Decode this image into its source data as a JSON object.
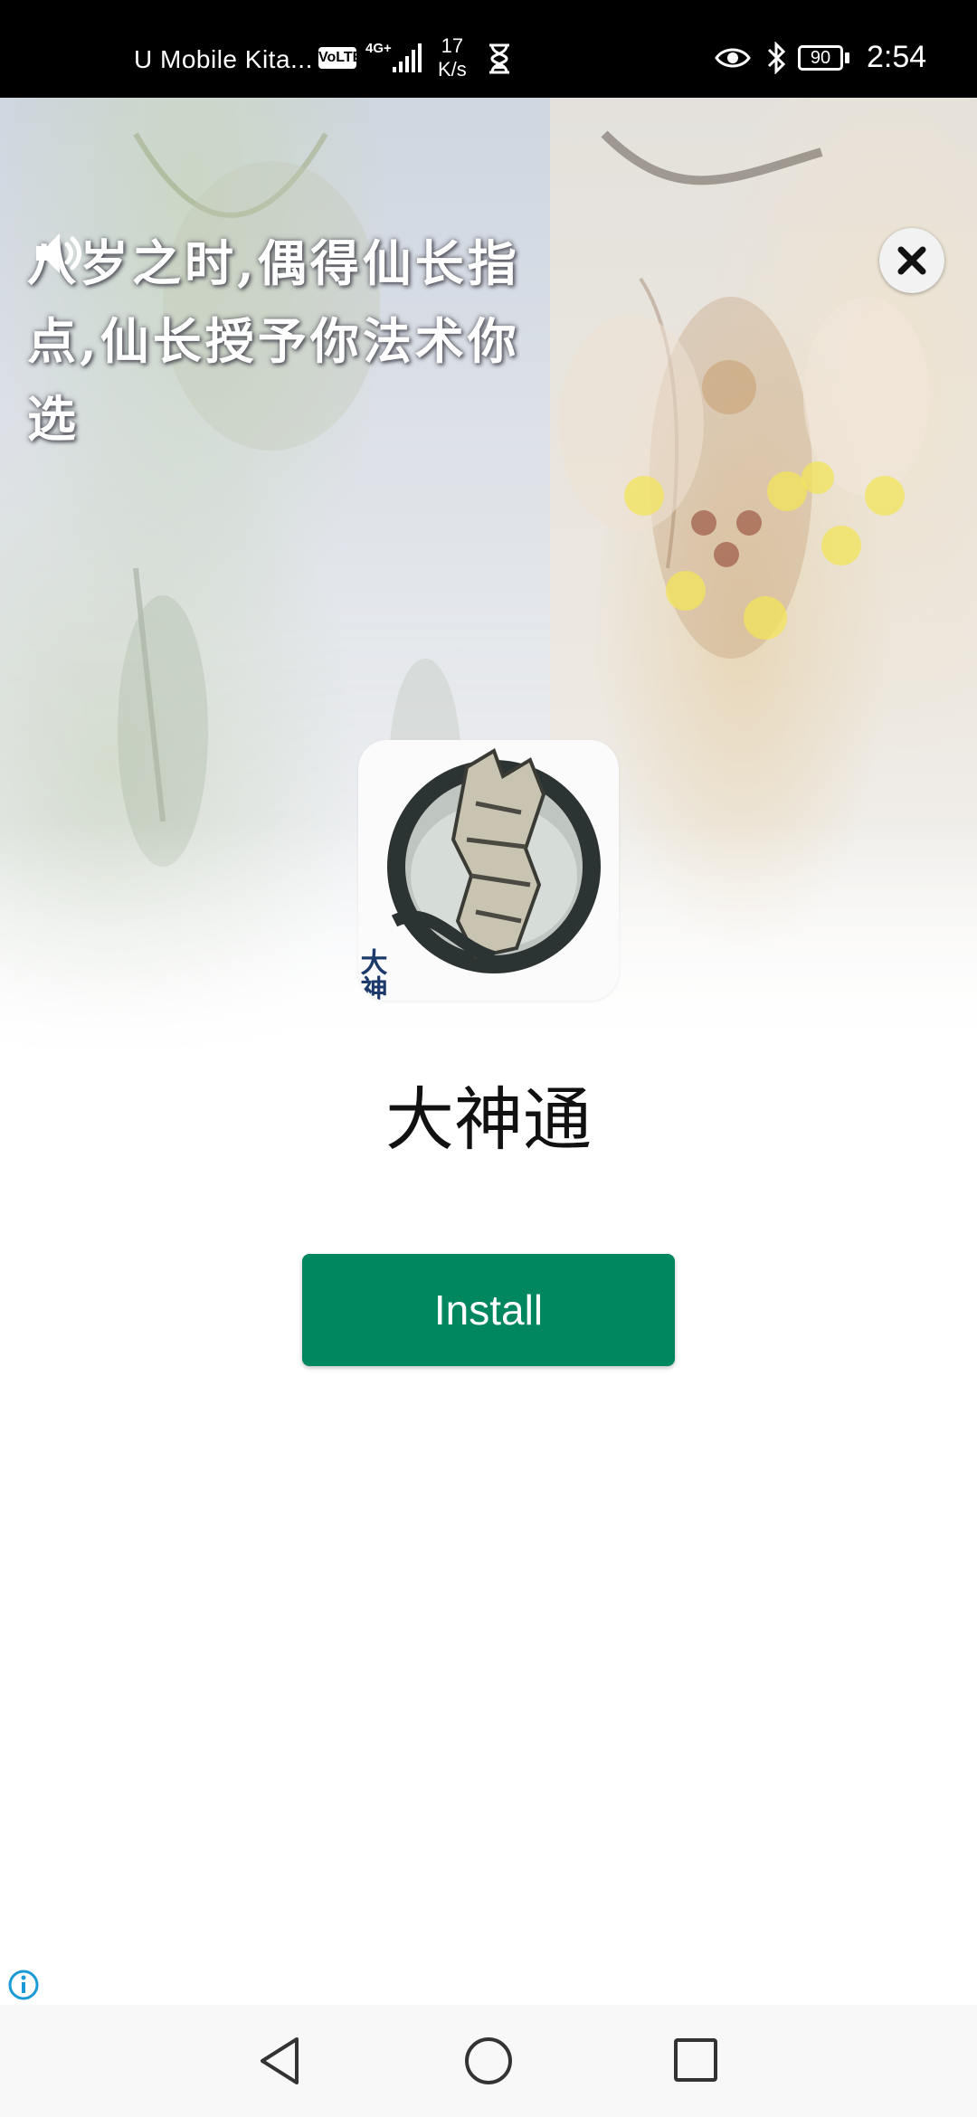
{
  "status_bar": {
    "carrier": "U Mobile Kita...",
    "volte": "VoLTE",
    "network": "4G+",
    "speed_value": "17",
    "speed_unit": "K/s",
    "battery": "90",
    "time": "2:54"
  },
  "ad": {
    "subtitle": "八岁之时,偶得仙长指点,仙长授予你法术你选",
    "app_name": "大神通",
    "icon_text": "大神通",
    "install_label": "Install"
  },
  "colors": {
    "install_button": "#01875f",
    "status_bar": "#000000"
  },
  "icons": [
    "volume-icon",
    "close-icon",
    "info-icon",
    "back-icon",
    "home-icon",
    "recents-icon"
  ]
}
